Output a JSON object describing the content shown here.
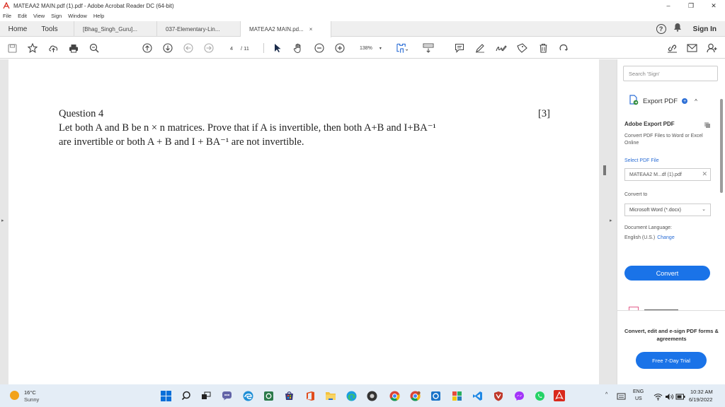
{
  "window": {
    "title": "MATEAA2 MAIN.pdf (1).pdf - Adobe Acrobat Reader DC (64-bit)",
    "minimize": "–",
    "maximize": "❐",
    "close": "✕"
  },
  "menu": [
    "File",
    "Edit",
    "View",
    "Sign",
    "Window",
    "Help"
  ],
  "tabs": {
    "home": "Home",
    "tools": "Tools",
    "documents": [
      {
        "label": "[Bhag_Singh_Guru]..."
      },
      {
        "label": "037-Elementary-Lin..."
      },
      {
        "label": "MATEAA2 MAIN.pd...",
        "close": "×"
      }
    ],
    "help": "?",
    "sign_in": "Sign In"
  },
  "toolbar": {
    "page_current": "4",
    "page_total": "/ 11",
    "zoom": "138%",
    "zoom_caret": "▾"
  },
  "document": {
    "question_title": "Question 4",
    "marks": "[3]",
    "line1": "Let both A and B be n × n matrices. Prove that if A is invertible, then both A+B and I+BA⁻¹",
    "line2": "are invertible or both A + B and I + BA⁻¹ are not invertible.",
    "left_arrow": "▸",
    "right_arrow": "▸"
  },
  "panel": {
    "search_placeholder": "Search 'Sign'",
    "export_label": "Export PDF",
    "export_badge": "+",
    "collapse_caret": "^",
    "export_title": "Adobe Export PDF",
    "export_desc": "Convert PDF Files to Word or Excel Online",
    "select_file_label": "Select PDF File",
    "file_name": "MATEAA2 M...df (1).pdf",
    "file_close": "✕",
    "convert_to_label": "Convert to",
    "format": "Microsoft Word (*.docx)",
    "format_caret": "⌄",
    "language_label": "Document Language:",
    "language": "English (U.S.)",
    "language_change": "Change",
    "convert_button": "Convert",
    "promo": "Convert, edit and e-sign PDF forms & agreements",
    "trial_button": "Free 7-Day Trial"
  },
  "taskbar": {
    "temperature": "16°C",
    "condition": "Sunny",
    "tray_caret": "^",
    "lang_top": "ENG",
    "lang_bottom": "US",
    "time": "10:32 AM",
    "date": "6/19/2022"
  },
  "colors": {
    "accent": "#1a73e8",
    "acrobat_red": "#d9291c",
    "taskbar": "#e4edf6"
  }
}
